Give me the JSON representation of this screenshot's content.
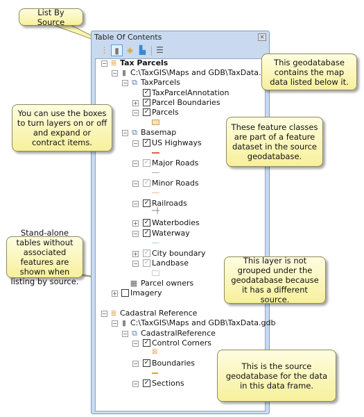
{
  "window": {
    "title": "Table Of Contents",
    "close_icon": "close-icon"
  },
  "toolbar": [
    {
      "name": "list-by-drawing-order",
      "icon": "layers-tree-icon",
      "glyph": "⋮"
    },
    {
      "name": "list-by-source",
      "icon": "database-icon",
      "glyph": "▮",
      "selected": true
    },
    {
      "name": "list-by-visibility",
      "icon": "layer-stack-icon",
      "glyph": "◈"
    },
    {
      "name": "list-by-selection",
      "icon": "selection-icon",
      "glyph": "▙"
    },
    {
      "name": "options",
      "icon": "options-list-icon",
      "glyph": "☰"
    }
  ],
  "tree": {
    "tax_parcels": "Tax Parcels",
    "gdb1": "C:\\TaxGIS\\Maps and GDB\\TaxData.gdb",
    "taxparcels_ds": "TaxParcels",
    "annotation": "TaxParcelAnnotation",
    "parcel_boundaries": "Parcel Boundaries",
    "parcels": "Parcels",
    "basemap": "Basemap",
    "us_highways": "US Highways",
    "major_roads": "Major Roads",
    "minor_roads": "Minor Roads",
    "railroads": "Railroads",
    "waterbodies": "Waterbodies",
    "waterway": "Waterway",
    "city_boundary": "City boundary",
    "landbase": "Landbase",
    "parcel_owners": "Parcel owners",
    "imagery": "Imagery",
    "cadastral": "Cadastral Reference",
    "gdb2": "C:\\TaxGIS\\Maps and GDB\\TaxData.gdb",
    "cadastral_ds": "CadastralReference",
    "control_corners": "Control Corners",
    "boundaries": "Boundaries",
    "sections": "Sections"
  },
  "callouts": {
    "list_by_source": "List By Source",
    "geodatabase": "This geodatabase contains the map data listed below it.",
    "boxes": "You can use the boxes to turn layers on or off and expand or contract items.",
    "feature_classes": "These feature classes are part of a feature dataset in the source geodatabase.",
    "standalone": "Stand-alone tables without associated features are shown when listing by source.",
    "not_grouped": "This layer is not grouped under the geodatabase because it has a different source.",
    "source_gdb": "This is the source geodatabase for the data in this data frame."
  },
  "colors": {
    "callout_fill": "#f9f4b0",
    "highway": "#e06040",
    "minor_road": "#e8c090",
    "waterway": "#a8d4ec",
    "parcel_fill": "#fbe2b4",
    "boundary": "#f0a000",
    "control_corner": "#f0a060"
  }
}
